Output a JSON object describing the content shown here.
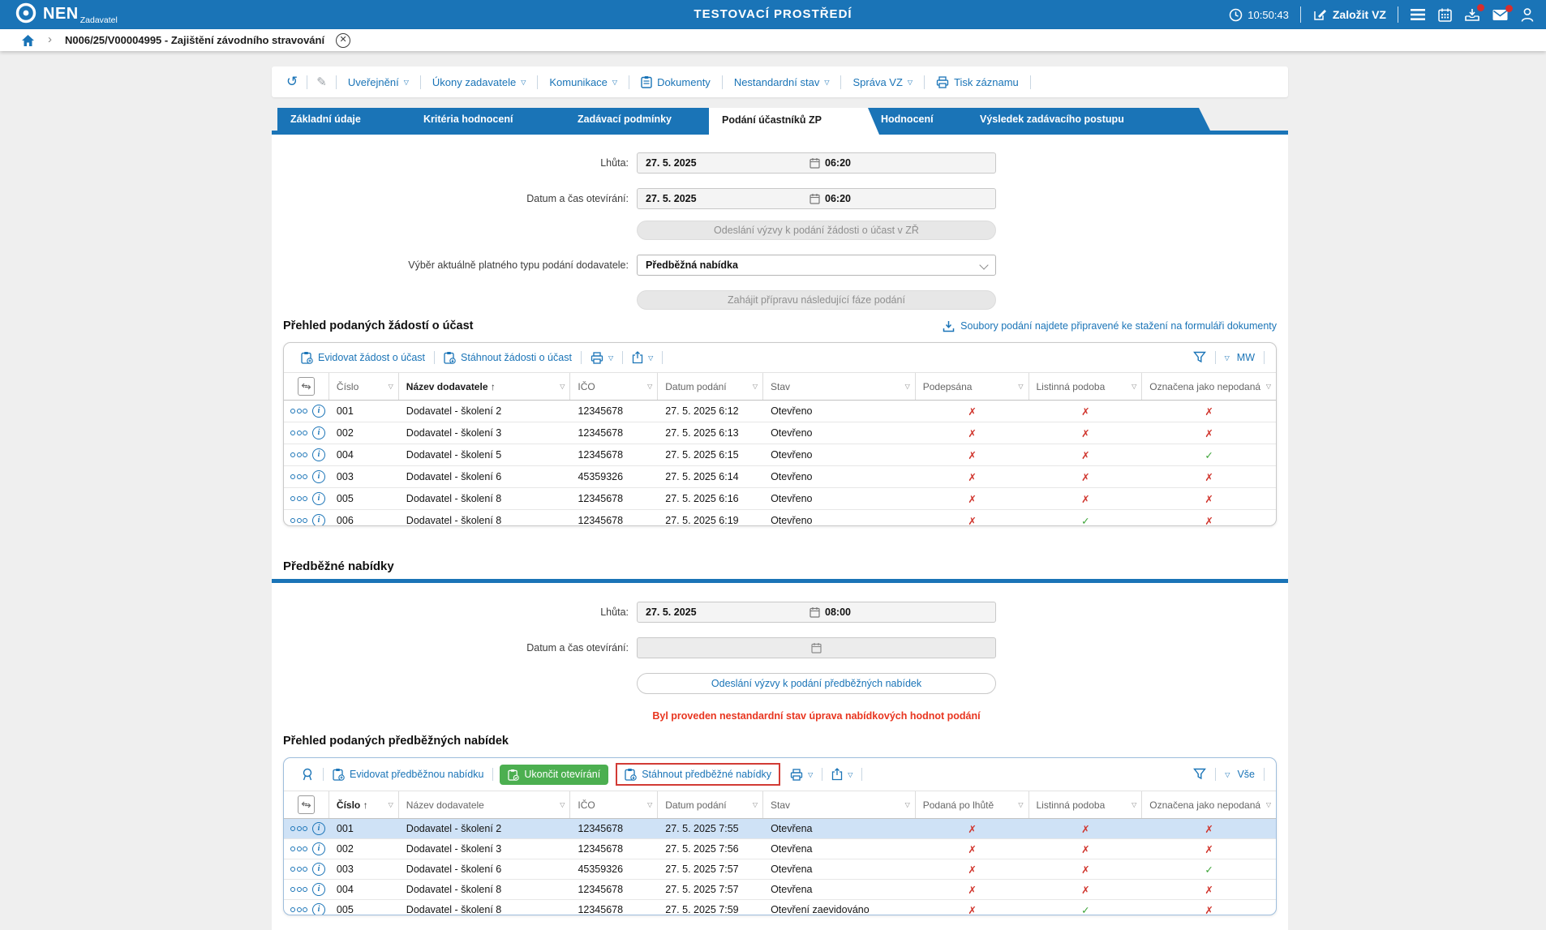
{
  "header": {
    "brand": "NEN",
    "brand_sub": "Zadavatel",
    "env_title": "TESTOVACÍ PROSTŘEDÍ",
    "time": "10:50:43",
    "create_vz": "Založit VZ"
  },
  "breadcrumb": {
    "title": "N006/25/V00004995 - Zajištění závodního stravování"
  },
  "actionbar": {
    "uverejneni": "Uveřejnění",
    "ukony": "Úkony zadavatele",
    "komunikace": "Komunikace",
    "dokumenty": "Dokumenty",
    "nestandardni": "Nestandardní stav",
    "sprava": "Správa VZ",
    "tisk": "Tisk záznamu"
  },
  "tabs": {
    "items": [
      "Základní údaje",
      "Kritéria hodnocení",
      "Zadávací podmínky",
      "Podání účastníků ZP",
      "Hodnocení",
      "Výsledek zadávacího postupu"
    ]
  },
  "phase1": {
    "lhuta_label": "Lhůta:",
    "lhuta_date": "27. 5. 2025",
    "lhuta_time": "06:20",
    "opening_label": "Datum a čas otevírání:",
    "opening_date": "27. 5. 2025",
    "opening_time": "06:20",
    "send_request_btn": "Odeslání výzvy k podání žádosti o účast v ZŘ",
    "select_label": "Výběr aktuálně platného typu podání dodavatele:",
    "select_value": "Předběžná nabídka",
    "next_phase_btn": "Zahájit přípravu následující fáze podání",
    "heading": "Přehled podaných žádostí o účast",
    "files_link": "Soubory podání najdete připravené ke stažení na formuláři dokumenty"
  },
  "table1": {
    "evidovat_btn": "Evidovat žádost o účast",
    "stahnout_btn": "Stáhnout žádosti o účast",
    "filter_label": "MW",
    "sorted_column": "Název dodavatele",
    "columns": [
      "Číslo",
      "Název dodavatele",
      "IČO",
      "Datum podání",
      "Stav",
      "Podepsána",
      "Listinná podoba",
      "Označena jako nepodaná"
    ],
    "rows": [
      {
        "num": "001",
        "name": "Dodavatel - školení 2",
        "ico": "12345678",
        "date": "27. 5. 2025 6:12",
        "stav": "Otevřeno",
        "marks": [
          "x",
          "x",
          "x"
        ]
      },
      {
        "num": "002",
        "name": "Dodavatel - školení 3",
        "ico": "12345678",
        "date": "27. 5. 2025 6:13",
        "stav": "Otevřeno",
        "marks": [
          "x",
          "x",
          "x"
        ]
      },
      {
        "num": "004",
        "name": "Dodavatel - školení 5",
        "ico": "12345678",
        "date": "27. 5. 2025 6:15",
        "stav": "Otevřeno",
        "marks": [
          "x",
          "x",
          "check"
        ]
      },
      {
        "num": "003",
        "name": "Dodavatel - školení 6",
        "ico": "45359326",
        "date": "27. 5. 2025 6:14",
        "stav": "Otevřeno",
        "marks": [
          "x",
          "x",
          "x"
        ]
      },
      {
        "num": "005",
        "name": "Dodavatel - školení 8",
        "ico": "12345678",
        "date": "27. 5. 2025 6:16",
        "stav": "Otevřeno",
        "marks": [
          "x",
          "x",
          "x"
        ]
      },
      {
        "num": "006",
        "name": "Dodavatel - školení 8",
        "ico": "12345678",
        "date": "27. 5. 2025 6:19",
        "stav": "Otevřeno",
        "marks": [
          "x",
          "check",
          "x"
        ]
      }
    ]
  },
  "phase2": {
    "heading": "Předběžné nabídky",
    "lhuta_label": "Lhůta:",
    "lhuta_date": "27. 5. 2025",
    "lhuta_time": "08:00",
    "opening_label": "Datum a čas otevírání:",
    "send_btn": "Odeslání výzvy k podání předběžných nabídek",
    "warning": "Byl proveden nestandardní stav úprava nabídkových hodnot podání",
    "table_heading": "Přehled podaných předběžných nabídek"
  },
  "table2": {
    "evidovat_btn": "Evidovat předběžnou nabídku",
    "ukoncit_btn": "Ukončit otevírání",
    "stahnout_btn": "Stáhnout předběžné nabídky",
    "filter_label": "Vše",
    "sorted_column": "Číslo",
    "columns": [
      "Číslo",
      "Název dodavatele",
      "IČO",
      "Datum podání",
      "Stav",
      "Podaná po lhůtě",
      "Listinná podoba",
      "Označena jako nepodaná"
    ],
    "rows": [
      {
        "num": "001",
        "name": "Dodavatel - školení 2",
        "ico": "12345678",
        "date": "27. 5. 2025 7:55",
        "stav": "Otevřena",
        "marks": [
          "x",
          "x",
          "x"
        ],
        "selected": true
      },
      {
        "num": "002",
        "name": "Dodavatel - školení 3",
        "ico": "12345678",
        "date": "27. 5. 2025 7:56",
        "stav": "Otevřena",
        "marks": [
          "x",
          "x",
          "x"
        ]
      },
      {
        "num": "003",
        "name": "Dodavatel - školení 6",
        "ico": "45359326",
        "date": "27. 5. 2025 7:57",
        "stav": "Otevřena",
        "marks": [
          "x",
          "x",
          "check"
        ]
      },
      {
        "num": "004",
        "name": "Dodavatel - školení 8",
        "ico": "12345678",
        "date": "27. 5. 2025 7:57",
        "stav": "Otevřena",
        "marks": [
          "x",
          "x",
          "x"
        ]
      },
      {
        "num": "005",
        "name": "Dodavatel - školení 8",
        "ico": "12345678",
        "date": "27. 5. 2025 7:59",
        "stav": "Otevření zaevidováno",
        "marks": [
          "x",
          "check",
          "x"
        ]
      }
    ]
  },
  "colors": {
    "accent_blue": "#1a74b7",
    "green_button": "#4caf50",
    "red_x": "#d0342c",
    "green_check": "#3aa335",
    "warning_red": "#e8351f",
    "selected_row": "#cfe2f6",
    "highlight_box": "#d23b35",
    "notification_dot": "#d62e2e"
  }
}
